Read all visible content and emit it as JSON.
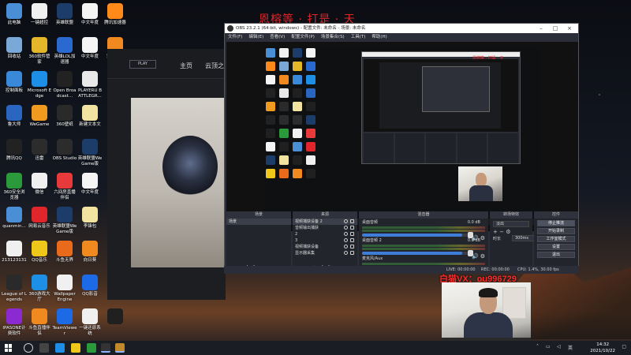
{
  "desktop_icons": [
    {
      "label": "此电脑",
      "color": "#4a8fd6"
    },
    {
      "label": "一键超控",
      "color": "#f0f0f0"
    },
    {
      "label": "英雄联盟",
      "color": "#1c3c6a"
    },
    {
      "label": "中文年度",
      "color": "#f5f5f5"
    },
    {
      "label": "腾讯加速器",
      "color": "#ff8a1a"
    },
    {
      "label": "回收站",
      "color": "#7aa9d8"
    },
    {
      "label": "360软件管家",
      "color": "#e4b72a"
    },
    {
      "label": "英雄LOL加速器",
      "color": "#2a6ad0"
    },
    {
      "label": "中文年度",
      "color": "#f5f5f5"
    },
    {
      "label": "穿越火线",
      "color": "#f08a20"
    },
    {
      "label": "控制面板",
      "color": "#3a88d8"
    },
    {
      "label": "Microsoft Edge",
      "color": "#1d8fe6"
    },
    {
      "label": "Open Broadcast...",
      "color": "#222222"
    },
    {
      "label": "PLAYERU BATTLEGR...",
      "color": "#e9e9e9"
    },
    {
      "label": "",
      "color": "#202020"
    },
    {
      "label": "鲁大师",
      "color": "#2a66c0"
    },
    {
      "label": "WeGame",
      "color": "#f09a20"
    },
    {
      "label": "360壁纸",
      "color": "#2a2a2a"
    },
    {
      "label": "新建文本文",
      "color": "#f2e3a0"
    },
    {
      "label": "",
      "color": "#202020"
    },
    {
      "label": "腾讯QQ",
      "color": "#222222"
    },
    {
      "label": "迅雷",
      "color": "#2c2c2c"
    },
    {
      "label": "OBS Studio",
      "color": "#2c2c2c"
    },
    {
      "label": "英雄联盟WeGame版",
      "color": "#1c3c6a"
    },
    {
      "label": "",
      "color": "#202020"
    },
    {
      "label": "360安全浏览器",
      "color": "#2a9a3a"
    },
    {
      "label": "微信",
      "color": "#f0f0f0"
    },
    {
      "label": "六间房直播伴侣",
      "color": "#e83a3a"
    },
    {
      "label": "中文年度",
      "color": "#f5f5f5"
    },
    {
      "label": "沃 Da",
      "color": "#202020"
    },
    {
      "label": "quanmin...",
      "color": "#4a8fd6"
    },
    {
      "label": "网易云音乐",
      "color": "#e0262b"
    },
    {
      "label": "英雄联盟WeGame版",
      "color": "#1c3c6a"
    },
    {
      "label": "李锋包",
      "color": "#f2e3a0"
    },
    {
      "label": "",
      "color": "#202020"
    },
    {
      "label": "213123131",
      "color": "#f0f0f0"
    },
    {
      "label": "QQ音乐",
      "color": "#f0c81a"
    },
    {
      "label": "斗鱼无界",
      "color": "#e86a1a"
    },
    {
      "label": "向日葵",
      "color": "#f08a20"
    },
    {
      "label": "",
      "color": "#202020"
    },
    {
      "label": "League of Legends",
      "color": "#2a2a2a"
    },
    {
      "label": "360游戏大厅",
      "color": "#1d8fe6"
    },
    {
      "label": "Wallpaper Engine",
      "color": "#f0f0f0"
    },
    {
      "label": "QQ影音",
      "color": "#1d6ae6"
    },
    {
      "label": "",
      "color": "#202020"
    },
    {
      "label": "IPASONE计费软件",
      "color": "#8a2ad0"
    },
    {
      "label": "斗鱼直播伴侣",
      "color": "#f08a20"
    },
    {
      "label": "TeamViewer",
      "color": "#1d6ae6"
    },
    {
      "label": "一键还原系统",
      "color": "#f0f0f0"
    },
    {
      "label": "",
      "color": "#202020"
    }
  ],
  "launcher": {
    "play_label": "PLAY",
    "tab_home": "主页",
    "tab_cloud": "云顶之"
  },
  "overlay": {
    "top_text": "恩榕等 · 打是 · 天",
    "vx_text": "白猫VX：ou996729"
  },
  "obs": {
    "title": "OBS 23.2.1 (64-bit, windows) - 配置文件: 未命名 - 场景: 未命名",
    "menu": [
      "文件(F)",
      "编辑(E)",
      "查看(V)",
      "配置文件(P)",
      "场景集合(S)",
      "工具(T)",
      "帮助(H)"
    ],
    "nested_label": "恩榕等 · 打是 · 天",
    "scenes": {
      "header": "场景",
      "items": [
        "场景"
      ]
    },
    "sources": {
      "header": "来源",
      "items": [
        "视频捕获设备 2",
        "音频输出捕获",
        "2",
        "3",
        "视频捕获设备",
        "显示器采集"
      ]
    },
    "mixer": {
      "header": "混音器",
      "channels": [
        {
          "name": "桌面音频",
          "db": "0.0 dB",
          "level": 0.92
        },
        {
          "name": "桌面音频 2",
          "db": "0.0 dB",
          "level": 0.92
        },
        {
          "name": "麦克风/Aux",
          "db": "",
          "level": 0.0
        }
      ]
    },
    "transitions": {
      "header": "转场特效",
      "selected": "淡出",
      "duration_label": "时长",
      "duration": "300ms"
    },
    "controls": {
      "header": "控件",
      "buttons": [
        "停止推流",
        "开始录制",
        "工作室模式",
        "设置",
        "退出"
      ]
    },
    "status": {
      "live": "LIVE: 00:00:00",
      "rec": "REC: 00:00:00",
      "cpu": "CPU: 1.4%, 30.00 fps"
    }
  },
  "taskbar": {
    "time": "14:32",
    "date": "2021/10/22"
  }
}
